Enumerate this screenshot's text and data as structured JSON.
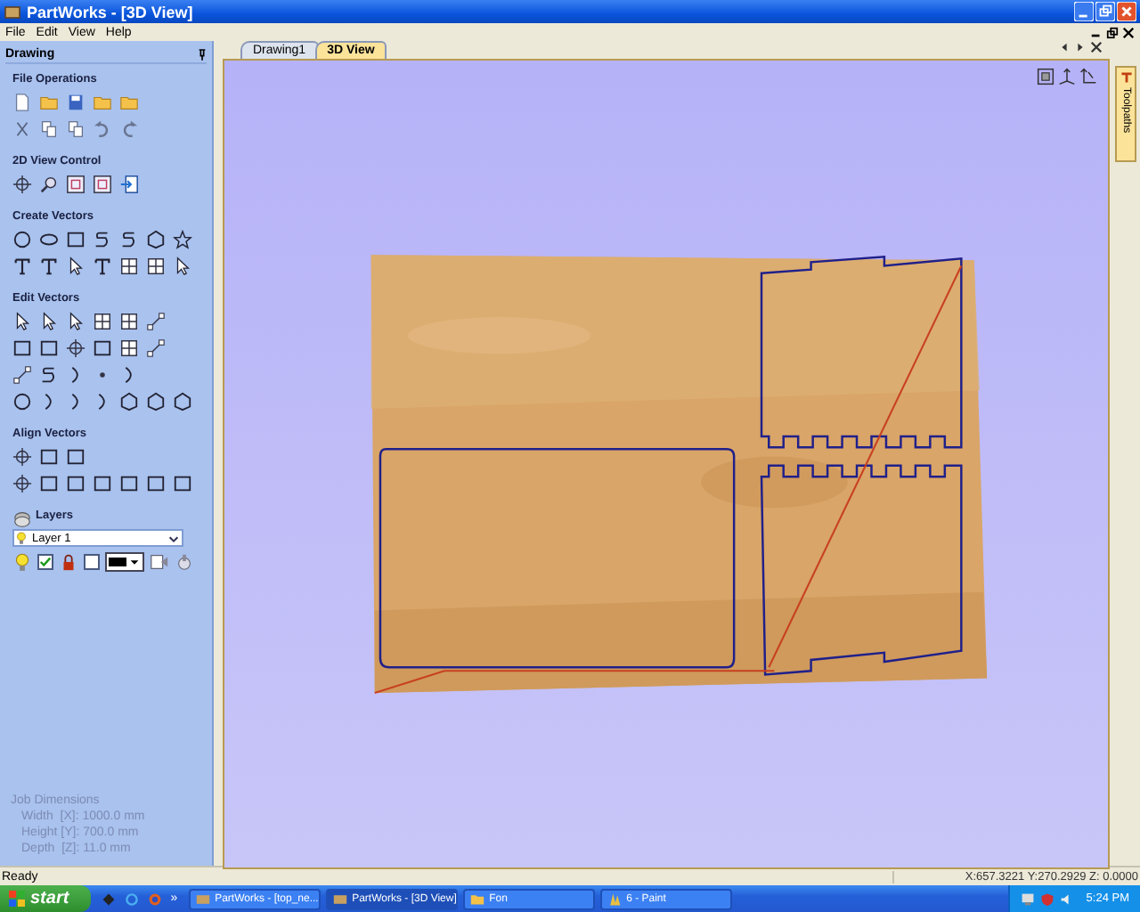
{
  "window": {
    "title": "PartWorks - [3D View]"
  },
  "menu": [
    "File",
    "Edit",
    "View",
    "Help"
  ],
  "panel": {
    "title": "Drawing",
    "sections": [
      {
        "title": "File Operations"
      },
      {
        "title": "2D View Control"
      },
      {
        "title": "Create Vectors"
      },
      {
        "title": "Edit Vectors"
      },
      {
        "title": "Align Vectors"
      }
    ],
    "layers": {
      "title": "Layers",
      "current": "Layer 1",
      "visible": true,
      "locked": false
    },
    "job_dimensions": {
      "title": "Job Dimensions",
      "lines": [
        "Width  [X]: 1000.0 mm",
        "Height [Y]: 700.0 mm",
        "Depth  [Z]: 11.0 mm"
      ]
    }
  },
  "tabs": [
    {
      "label": "Drawing1",
      "selected": false
    },
    {
      "label": "3D View",
      "selected": true
    }
  ],
  "side_tab": "Toolpaths",
  "status_bar": {
    "message": "Ready",
    "coordinates": "X:657.3221 Y:270.2929 Z: 0.0000"
  },
  "taskbar": {
    "start": "start",
    "more": "»",
    "buttons": [
      {
        "label": "PartWorks - [top_ne...",
        "selected": false,
        "kind": "app"
      },
      {
        "label": "PartWorks - [3D View]",
        "selected": true,
        "kind": "app"
      },
      {
        "label": "Fon",
        "selected": false,
        "kind": "folder"
      },
      {
        "label": "6 - Paint",
        "selected": false,
        "kind": "paint"
      }
    ],
    "clock": "5:24 PM"
  }
}
